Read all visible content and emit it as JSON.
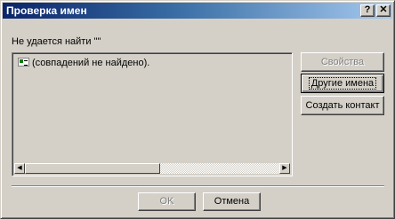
{
  "window": {
    "title": "Проверка имен",
    "help_button": "?",
    "close_button": "✕"
  },
  "prompt_label": "Не удается найти \"\"",
  "results": {
    "items": [
      {
        "text": "(совпадений не найдено)."
      }
    ]
  },
  "scrollbar": {
    "left_arrow": "◀",
    "right_arrow": "▶"
  },
  "side_buttons": {
    "properties_label": "Свойства",
    "other_names_label": "Другие имена",
    "create_contact_label": "Создать контакт"
  },
  "footer": {
    "ok_label": "OK",
    "cancel_label": "Отмена"
  }
}
